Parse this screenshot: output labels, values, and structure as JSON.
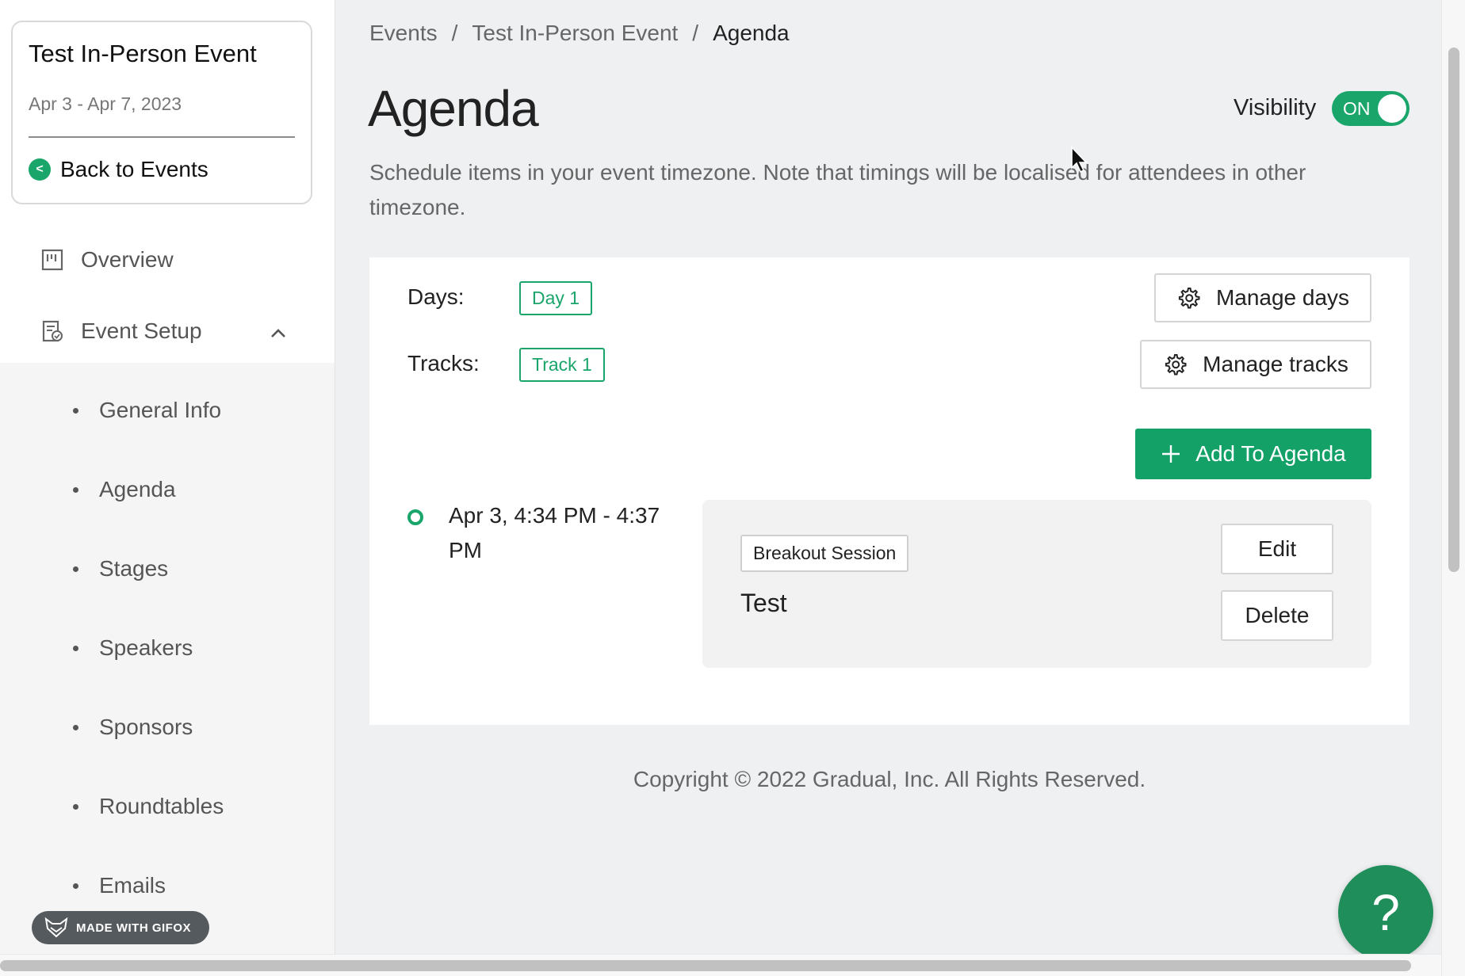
{
  "sidebar": {
    "event_title": "Test In-Person Event",
    "event_dates": "Apr 3 - Apr 7, 2023",
    "back_label": "Back to Events",
    "nav": [
      {
        "label": "Overview",
        "icon": "overview-icon"
      },
      {
        "label": "Event Setup",
        "icon": "event-setup-icon",
        "expanded": true
      }
    ],
    "sub_items": [
      "General Info",
      "Agenda",
      "Stages",
      "Speakers",
      "Sponsors",
      "Roundtables",
      "Emails"
    ],
    "gifox_badge": "MADE WITH GIFOX"
  },
  "breadcrumb": {
    "items": [
      "Events",
      "Test In-Person Event",
      "Agenda"
    ],
    "separator": "/"
  },
  "header": {
    "title": "Agenda",
    "visibility_label": "Visibility",
    "visibility_state": "ON",
    "description": "Schedule items in your event timezone. Note that timings will be localised for attendees in other timezone."
  },
  "panel": {
    "days_label": "Days:",
    "day_tag": "Day 1",
    "tracks_label": "Tracks:",
    "track_tag": "Track 1",
    "manage_days": "Manage days",
    "manage_tracks": "Manage tracks",
    "add_to_agenda": "Add To Agenda",
    "items": [
      {
        "time": "Apr 3, 4:34 PM - 4:37 PM",
        "type": "Breakout Session",
        "title": "Test",
        "edit_label": "Edit",
        "delete_label": "Delete"
      }
    ]
  },
  "footer": {
    "copyright": "Copyright © 2022 Gradual, Inc. All Rights Reserved."
  },
  "help": {
    "label": "?"
  },
  "colors": {
    "accent": "#1aa56b",
    "add_button": "#13a168",
    "help_button": "#1f8e5a",
    "background": "#eef0f2"
  }
}
